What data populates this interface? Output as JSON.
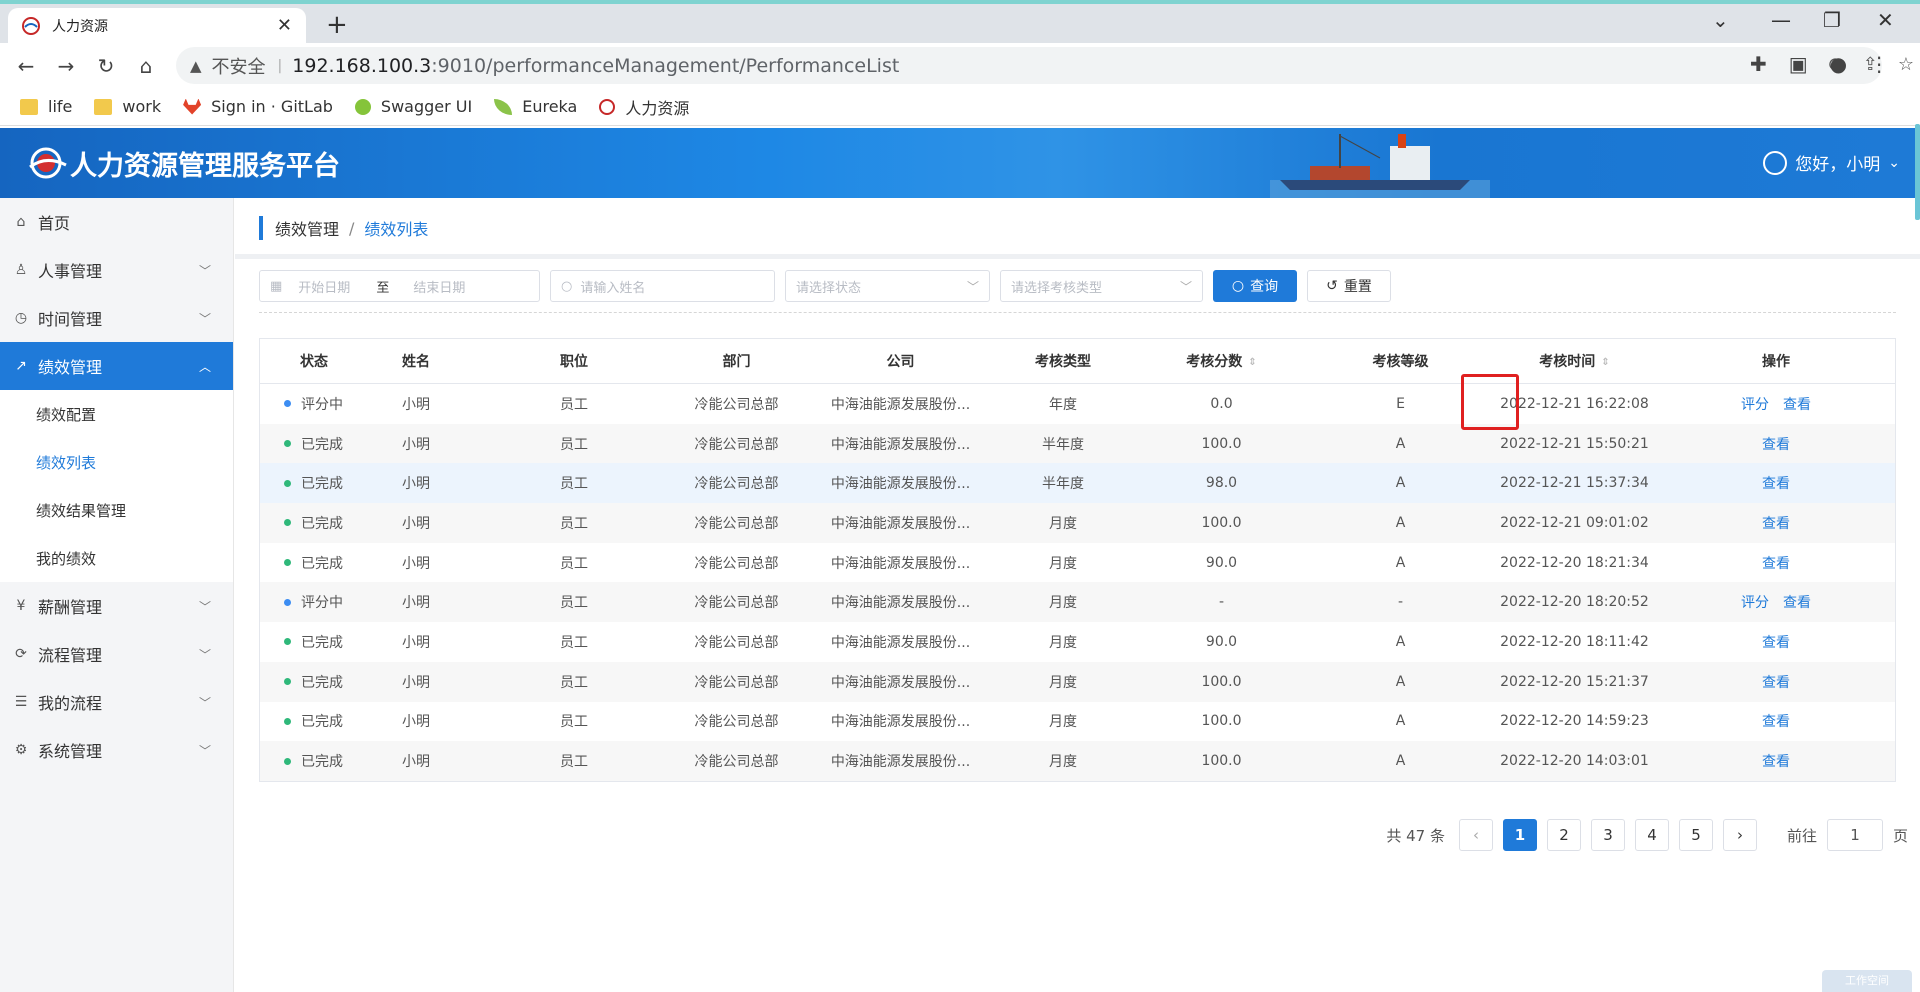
{
  "browser": {
    "tab_title": "人力资源",
    "omnibox": {
      "security": "不安全",
      "host": "192.168.100.3",
      "path": ":9010/performanceManagement/PerformanceList"
    },
    "bookmarks": [
      "life",
      "work",
      "Sign in · GitLab",
      "Swagger UI",
      "Eureka",
      "人力资源"
    ]
  },
  "header": {
    "title": "人力资源管理服务平台",
    "greeting": "您好，小明"
  },
  "sidebar": {
    "items": [
      {
        "label": "首页",
        "icon": "home-icon"
      },
      {
        "label": "人事管理",
        "icon": "person-icon"
      },
      {
        "label": "时间管理",
        "icon": "clock-icon"
      },
      {
        "label": "绩效管理",
        "icon": "chart-icon",
        "active": true
      },
      {
        "label": "薪酬管理",
        "icon": "yen-icon"
      },
      {
        "label": "流程管理",
        "icon": "flow-icon"
      },
      {
        "label": "我的流程",
        "icon": "doc-icon"
      },
      {
        "label": "系统管理",
        "icon": "gear-icon"
      }
    ],
    "sub_items": [
      "绩效配置",
      "绩效列表",
      "绩效结果管理",
      "我的绩效"
    ]
  },
  "breadcrumb": {
    "parent": "绩效管理",
    "separator": "/",
    "current": "绩效列表"
  },
  "filters": {
    "start_placeholder": "开始日期",
    "range_separator": "至",
    "end_placeholder": "结束日期",
    "name_placeholder": "请输入姓名",
    "status_placeholder": "请选择状态",
    "type_placeholder": "请选择考核类型",
    "query_label": "查询",
    "reset_label": "重置"
  },
  "table": {
    "headers": [
      "状态",
      "姓名",
      "职位",
      "部门",
      "公司",
      "考核类型",
      "考核分数",
      "考核等级",
      "考核时间",
      "操作"
    ],
    "rows": [
      {
        "status": "评分中",
        "dot": "blue",
        "name": "小明",
        "position": "员工",
        "dept": "冷能公司总部",
        "company": "中海油能源发展股份...",
        "type": "年度",
        "score": "0.0",
        "grade": "E",
        "time": "2022-12-21 16:22:08",
        "ops": [
          "评分",
          "查看"
        ]
      },
      {
        "status": "已完成",
        "dot": "green",
        "name": "小明",
        "position": "员工",
        "dept": "冷能公司总部",
        "company": "中海油能源发展股份...",
        "type": "半年度",
        "score": "100.0",
        "grade": "A",
        "time": "2022-12-21 15:50:21",
        "ops": [
          "查看"
        ]
      },
      {
        "status": "已完成",
        "dot": "green",
        "name": "小明",
        "position": "员工",
        "dept": "冷能公司总部",
        "company": "中海油能源发展股份...",
        "type": "半年度",
        "score": "98.0",
        "grade": "A",
        "time": "2022-12-21 15:37:34",
        "ops": [
          "查看"
        ]
      },
      {
        "status": "已完成",
        "dot": "green",
        "name": "小明",
        "position": "员工",
        "dept": "冷能公司总部",
        "company": "中海油能源发展股份...",
        "type": "月度",
        "score": "100.0",
        "grade": "A",
        "time": "2022-12-21 09:01:02",
        "ops": [
          "查看"
        ]
      },
      {
        "status": "已完成",
        "dot": "green",
        "name": "小明",
        "position": "员工",
        "dept": "冷能公司总部",
        "company": "中海油能源发展股份...",
        "type": "月度",
        "score": "90.0",
        "grade": "A",
        "time": "2022-12-20 18:21:34",
        "ops": [
          "查看"
        ]
      },
      {
        "status": "评分中",
        "dot": "blue",
        "name": "小明",
        "position": "员工",
        "dept": "冷能公司总部",
        "company": "中海油能源发展股份...",
        "type": "月度",
        "score": "-",
        "grade": "-",
        "time": "2022-12-20 18:20:52",
        "ops": [
          "评分",
          "查看"
        ]
      },
      {
        "status": "已完成",
        "dot": "green",
        "name": "小明",
        "position": "员工",
        "dept": "冷能公司总部",
        "company": "中海油能源发展股份...",
        "type": "月度",
        "score": "90.0",
        "grade": "A",
        "time": "2022-12-20 18:11:42",
        "ops": [
          "查看"
        ]
      },
      {
        "status": "已完成",
        "dot": "green",
        "name": "小明",
        "position": "员工",
        "dept": "冷能公司总部",
        "company": "中海油能源发展股份...",
        "type": "月度",
        "score": "100.0",
        "grade": "A",
        "time": "2022-12-20 15:21:37",
        "ops": [
          "查看"
        ]
      },
      {
        "status": "已完成",
        "dot": "green",
        "name": "小明",
        "position": "员工",
        "dept": "冷能公司总部",
        "company": "中海油能源发展股份...",
        "type": "月度",
        "score": "100.0",
        "grade": "A",
        "time": "2022-12-20 14:59:23",
        "ops": [
          "查看"
        ]
      },
      {
        "status": "已完成",
        "dot": "green",
        "name": "小明",
        "position": "员工",
        "dept": "冷能公司总部",
        "company": "中海油能源发展股份...",
        "type": "月度",
        "score": "100.0",
        "grade": "A",
        "time": "2022-12-20 14:03:01",
        "ops": [
          "查看"
        ]
      }
    ]
  },
  "pagination": {
    "total": "共 47 条",
    "pages": [
      "1",
      "2",
      "3",
      "4",
      "5"
    ],
    "current": "1",
    "goto_prefix": "前往",
    "goto_value": "1",
    "goto_suffix": "页"
  },
  "corner_badge": "工作空间",
  "colors": {
    "primary": "#1f7ad9",
    "status_blue": "#3c8df2",
    "status_green": "#2fb87a",
    "highlight_box": "#e02020"
  }
}
